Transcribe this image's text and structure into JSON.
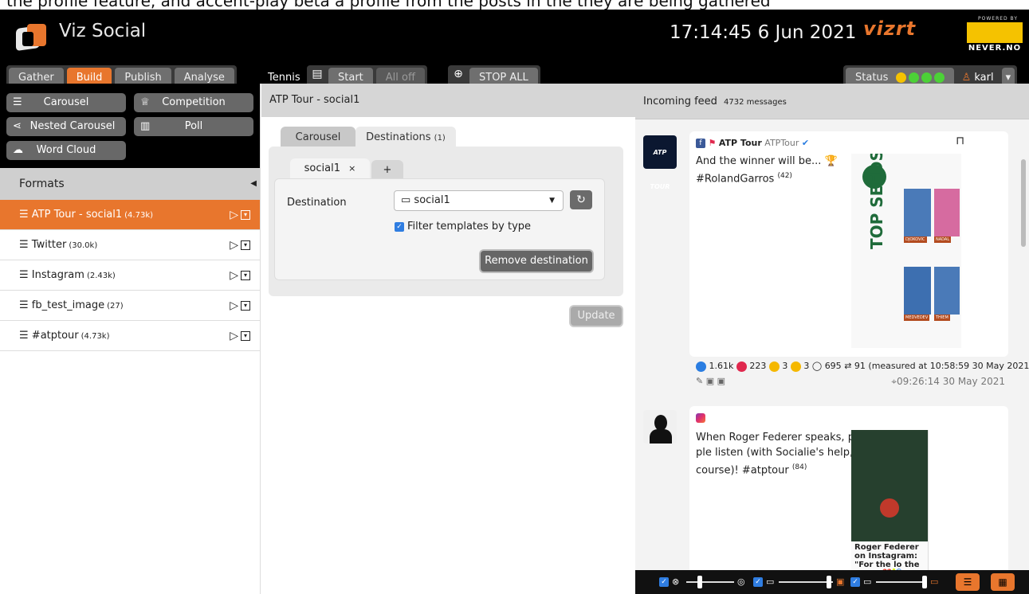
{
  "caption": {
    "text": "the profile feature, and accent-play beta a profile from the posts in the they are being gathered"
  },
  "header": {
    "app_title": "Viz Social",
    "clock": "17:14:45 6 Jun 2021",
    "vizrt_logo": "vizrt",
    "powered_by": "POWERED BY",
    "never_logo": "NEVER.NO"
  },
  "nav": {
    "gather": "Gather",
    "build": "Build",
    "publish": "Publish",
    "analyse": "Analyse",
    "tennis": "Tennis",
    "start": "Start",
    "all_off": "All off",
    "stop_all": "STOP ALL",
    "status": "Status",
    "user": "karl"
  },
  "types": {
    "carousel": "Carousel",
    "competition": "Competition",
    "nested_carousel": "Nested Carousel",
    "poll": "Poll",
    "word_cloud": "Word Cloud"
  },
  "formats": {
    "heading": "Formats",
    "items": [
      {
        "name": "ATP Tour - social1",
        "count": "(4.73k)"
      },
      {
        "name": "Twitter",
        "count": "(30.0k)"
      },
      {
        "name": "Instagram",
        "count": "(2.43k)"
      },
      {
        "name": "fb_test_image",
        "count": "(27)"
      },
      {
        "name": "#atptour",
        "count": "(4.73k)"
      }
    ]
  },
  "editor": {
    "title": "ATP Tour - social1",
    "tab_carousel": "Carousel",
    "tab_destinations": "Destinations",
    "tab_destinations_count": "(1)",
    "subtab_social1": "social1",
    "close_glyph": "×",
    "add_glyph": "+",
    "destination_label": "Destination",
    "destination_value": "social1",
    "filter_label": "Filter templates by type",
    "remove_button": "Remove destination",
    "update_button": "Update"
  },
  "feed": {
    "title": "Incoming feed",
    "count": "4732 messages",
    "post1": {
      "author": "ATP Tour",
      "handle": "ATPTour",
      "text_line1": "And the winner will be... 🏆",
      "text_line2": "#RolandGarros",
      "score": "(42)",
      "stats": "1.61k 223 3 3 695 91",
      "likes": "1.61k",
      "loves": "223",
      "haha": "3",
      "wow": "3",
      "comments": "695",
      "shares": "91",
      "measured": "(measured at 10:58:59 30 May 2021)",
      "time": "09:26:14 30 May 2021",
      "image_text": "TOP SEEDS",
      "players": [
        "DJOKOVIC",
        "NADAL",
        "MEDVEDEV",
        "THIEM"
      ],
      "avatar_text": "ATP TOUR"
    },
    "post2": {
      "text_line1": "When Roger Federer speaks, peo-",
      "text_line2": "ple listen (with Socialie's help, of",
      "text_line3": "course)! #atptour",
      "score": "(84)",
      "image_caption": "Roger Federer on Instagram: \"For the lo the game ❤️🎾\""
    }
  },
  "colors": {
    "accent": "#e8762d",
    "status_yellow": "#f5c200",
    "status_green": "#4cd137"
  }
}
